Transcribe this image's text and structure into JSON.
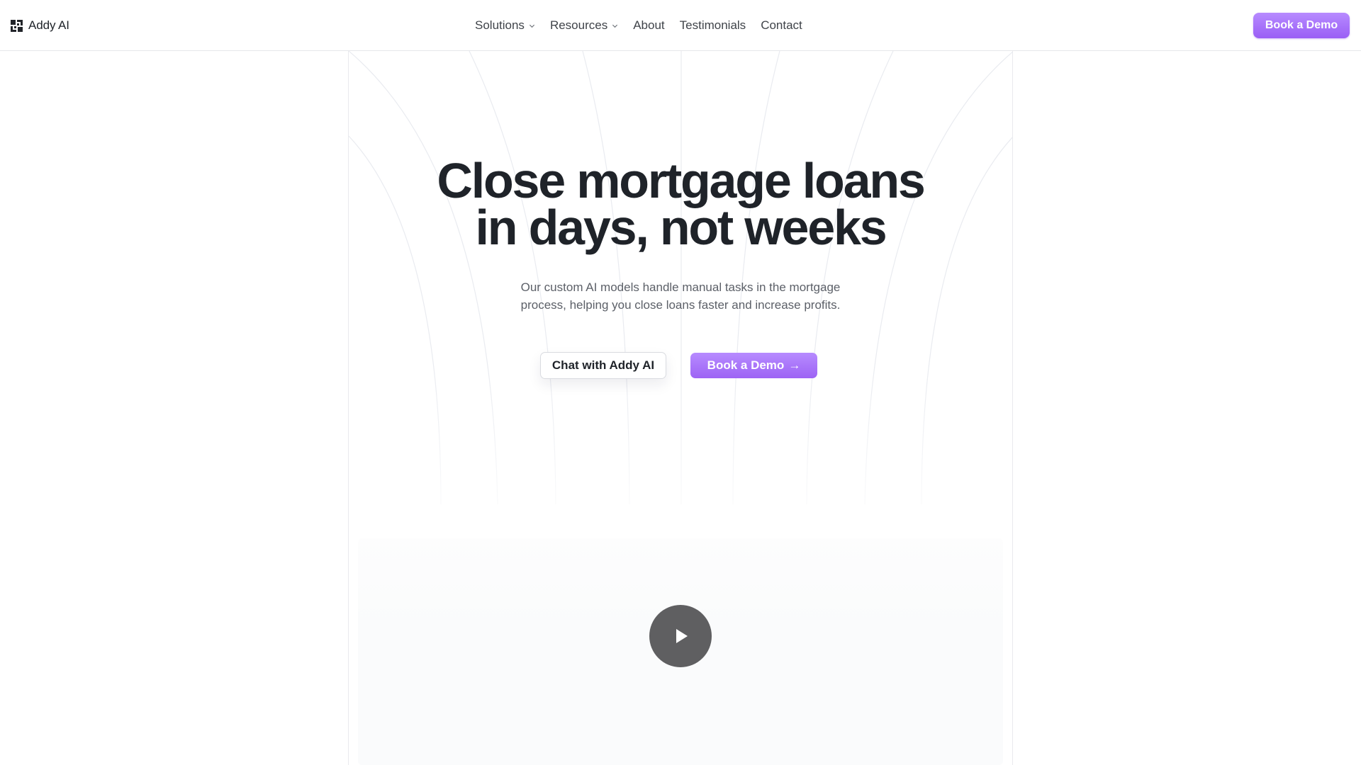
{
  "brand": {
    "name": "Addy AI",
    "logo_icon": "addy-logo-icon"
  },
  "nav": {
    "items": [
      {
        "label": "Solutions",
        "has_dropdown": true,
        "icon": "chevron-down-icon"
      },
      {
        "label": "Resources",
        "has_dropdown": true,
        "icon": "chevron-down-icon"
      },
      {
        "label": "About",
        "has_dropdown": false
      },
      {
        "label": "Testimonials",
        "has_dropdown": false
      },
      {
        "label": "Contact",
        "has_dropdown": false
      }
    ],
    "cta_label": "Book a Demo"
  },
  "hero": {
    "title_line1": "Close mortgage loans",
    "title_line2": "in days, not weeks",
    "subtitle_line1": "Our custom AI models handle manual tasks in the mortgage",
    "subtitle_line2": "process, helping you close loans faster and increase profits.",
    "chat_button": "Chat with Addy AI",
    "demo_button": "Book a Demo",
    "demo_arrow": "→"
  },
  "video": {
    "play_icon": "play-icon"
  },
  "colors": {
    "accent": "#a36cf7",
    "text_primary": "#1f2329",
    "text_secondary": "#5c6068",
    "border": "#e6e7ea",
    "play_button": "#5f5f61"
  }
}
